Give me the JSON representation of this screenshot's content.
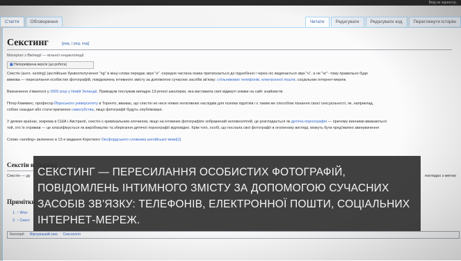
{
  "topbar": {
    "user": "Вхід не зареєстр."
  },
  "tabs_left": [
    "Стаття",
    "Обговорення"
  ],
  "tabs_right": [
    "Читати",
    "Редагувати",
    "Редагувати код",
    "Переглянути історію"
  ],
  "article": {
    "title": "Секстинг",
    "title_edit": "[ред. | ред. код]",
    "subline": "Матеріал з Вікіпедії — вільної енциклопедії",
    "review": "Неперевірена версія (ця робота)",
    "p1_line1": "Секстін (англ. sexting) (англійське буквосполучення \"ng\" в кінці слова передає звук \"н\" -середня частина язика притискається до піднебіння і через ніс видихається звук \"н\", а не \"нг\"- тому правильно буде",
    "p1_line2a": "вимова ",
    "p1_line2b": "— пересилання особистих фотографій, повідомлень інтимного змісту за допомогою сучасних засобів зв'язку: ",
    "p1_links": "стільникових телефонів, електронної пошти",
    "p1_line2c": ", соціальних інтернет-мереж.",
    "p2a": "Визначення з'явилося у ",
    "p2_link": "2005 році у Новій Зеландії",
    "p2b": ". Приводом послужив випадок 13-річної школярки, яка виставила свої відверті знімки на сайт знайомств.",
    "p3a": "Пітер Камминс, професор ",
    "p3_link": "Йоркського університету",
    "p3b": " в Торонто, вважає, що секстін не несе ніяких негативних наслідків для психіки підлітків і є таким же способом пізнання своєї сексуальності, як, наприклад,",
    "p3_line2a": "собою скандал або стати причиною ",
    "p3_link2": "самогубства",
    "p3_line2b": ", якщо фотографії будуть опубліковані.",
    "p4_line1a": "У деяких країнах, зокрема в США і Австралії, секстін є кримінальним злочином, якщо на інтимних фотографіях зображений неповнолітній, це розглядається як ",
    "p4_link": "дитяча порнографія",
    "p4_line1b": " — причому винними вважаються",
    "p4_line2": "той, хто їх отримав — це класифікується як виробництво та зберігання дитячої порнографії відповідно. Крім того, особі, що послала свої фотографії в оголеному вигляді, можуть бути пред'явлені звинувачення",
    "p5a": "Слово «sexting» включено в 12-е видання Короткого ",
    "p5_link": "Оксфордського словника англійської мови",
    "p5b": "[1]"
  },
  "section_sources": {
    "heading": "Секстін в Україні",
    "line1a": "Секстін",
    "line1b": "— ду",
    "line1_right": "поглядах з метою"
  },
  "section_notes": {
    "heading": "Примітки",
    "item1": "1. ↑ Woo",
    "item2": "2. ↑ Секст"
  },
  "categories": {
    "label": "Категорії:",
    "items": [
      "Віртуальний секс",
      "Сексологія"
    ]
  },
  "overlay": {
    "text": "Секстинг — пересилання особистих фотографій, повідомлень інтимного змісту за допомогою сучасних засобів зв'язку: телефонів, електронної пошти, соціальних інтернет-мереж."
  }
}
